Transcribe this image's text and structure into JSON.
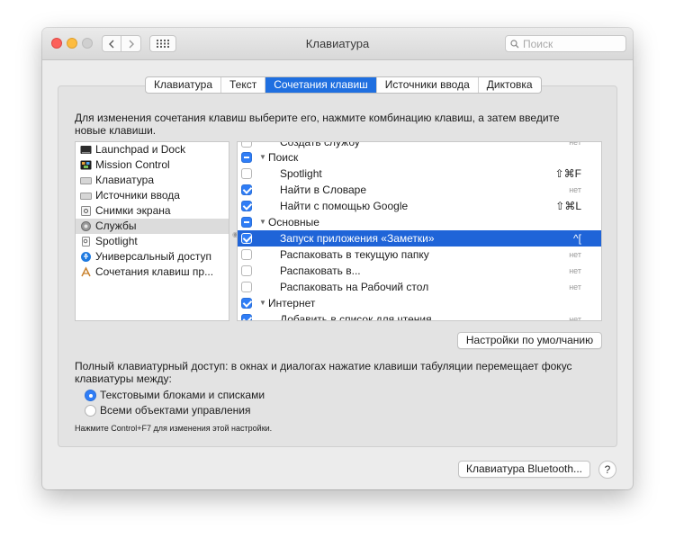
{
  "window": {
    "title": "Клавиатура"
  },
  "toolbar": {
    "search_placeholder": "Поиск"
  },
  "tabs": [
    {
      "label": "Клавиатура",
      "active": false
    },
    {
      "label": "Текст",
      "active": false
    },
    {
      "label": "Сочетания клавиш",
      "active": true
    },
    {
      "label": "Источники ввода",
      "active": false
    },
    {
      "label": "Диктовка",
      "active": false
    }
  ],
  "description": "Для изменения сочетания клавиш выберите его, нажмите комбинацию клавиш, а затем введите новые клавиши.",
  "categories": [
    {
      "label": "Launchpad и Dock",
      "icon": "launchpad-icon"
    },
    {
      "label": "Mission Control",
      "icon": "mission-control-icon"
    },
    {
      "label": "Клавиатура",
      "icon": "keyboard-icon"
    },
    {
      "label": "Источники ввода",
      "icon": "input-sources-icon"
    },
    {
      "label": "Снимки экрана",
      "icon": "screenshot-icon"
    },
    {
      "label": "Службы",
      "icon": "services-gear-icon",
      "selected": true
    },
    {
      "label": "Spotlight",
      "icon": "spotlight-icon"
    },
    {
      "label": "Универсальный доступ",
      "icon": "accessibility-icon"
    },
    {
      "label": "Сочетания клавиш пр...",
      "icon": "app-shortcuts-icon"
    }
  ],
  "shortcuts": [
    {
      "type": "item",
      "label": "Создать службу",
      "checked": false,
      "shortcut": "нет",
      "partial": true
    },
    {
      "type": "group",
      "label": "Поиск",
      "state": "mixed"
    },
    {
      "type": "item",
      "label": "Spotlight",
      "checked": false,
      "shortcut": "⇧⌘F"
    },
    {
      "type": "item",
      "label": "Найти в Словаре",
      "checked": true,
      "shortcut": "нет"
    },
    {
      "type": "item",
      "label": "Найти с помощью Google",
      "checked": true,
      "shortcut": "⇧⌘L"
    },
    {
      "type": "group",
      "label": "Основные",
      "state": "mixed"
    },
    {
      "type": "item",
      "label": "Запуск приложения «Заметки»",
      "checked": true,
      "shortcut": "^[",
      "selected": true
    },
    {
      "type": "item",
      "label": "Распаковать в текущую папку",
      "checked": false,
      "shortcut": "нет"
    },
    {
      "type": "item",
      "label": "Распаковать в...",
      "checked": false,
      "shortcut": "нет"
    },
    {
      "type": "item",
      "label": "Распаковать на Рабочий стол",
      "checked": false,
      "shortcut": "нет"
    },
    {
      "type": "group",
      "label": "Интернет",
      "state": "checked"
    },
    {
      "type": "item",
      "label": "Добавить в список для чтения",
      "checked": true,
      "shortcut": "нет"
    }
  ],
  "buttons": {
    "defaults": "Настройки по умолчанию",
    "bluetooth": "Клавиатура Bluetooth...",
    "help": "?"
  },
  "keyboard_access": {
    "text": "Полный клавиатурный доступ: в окнах и диалогах нажатие клавиши табуляции перемещает фокус клавиатуры между:",
    "options": [
      {
        "label": "Текстовыми блоками и списками",
        "selected": true
      },
      {
        "label": "Всеми объектами управления",
        "selected": false
      }
    ],
    "hint": "Нажмите Control+F7 для изменения этой настройки."
  }
}
